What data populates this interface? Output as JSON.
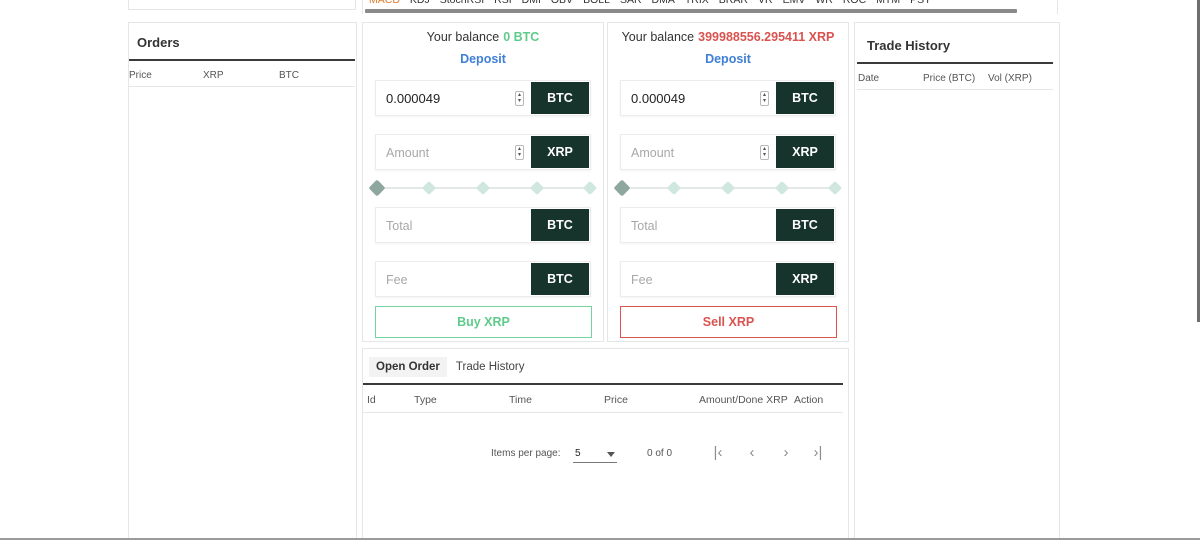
{
  "indicators": [
    "MACD",
    "KDJ",
    "StochRSI",
    "RSI",
    "DMI",
    "OBV",
    "BOLL",
    "SAR",
    "DMA",
    "TRIX",
    "BRAR",
    "VR",
    "EMV",
    "WR",
    "ROC",
    "MTM",
    "PSY"
  ],
  "orders": {
    "title": "Orders",
    "columns": [
      "Price",
      "XRP",
      "BTC"
    ]
  },
  "buy": {
    "balance_label": "Your balance",
    "balance_value": "0 BTC",
    "deposit": "Deposit",
    "price_value": "0.000049",
    "price_unit": "BTC",
    "amount_placeholder": "Amount",
    "amount_unit": "XRP",
    "total_placeholder": "Total",
    "total_unit": "BTC",
    "fee_placeholder": "Fee",
    "fee_unit": "BTC",
    "action": "Buy XRP",
    "accent": "#5ecb8a"
  },
  "sell": {
    "balance_label": "Your balance",
    "balance_value": "399988556.295411 XRP",
    "deposit": "Deposit",
    "price_value": "0.000049",
    "price_unit": "BTC",
    "amount_placeholder": "Amount",
    "amount_unit": "XRP",
    "total_placeholder": "Total",
    "total_unit": "BTC",
    "fee_placeholder": "Fee",
    "fee_unit": "XRP",
    "action": "Sell XRP",
    "accent": "#d9534f"
  },
  "open_orders": {
    "tabs": [
      "Open Order",
      "Trade History"
    ],
    "columns": [
      "Id",
      "Type",
      "Time",
      "Price",
      "Amount/Done XRP",
      "Action"
    ],
    "items_per_page_label": "Items per page:",
    "items_per_page_value": "5",
    "range": "0 of 0"
  },
  "trade_history": {
    "title": "Trade History",
    "columns": [
      "Date",
      "Price (BTC)",
      "Vol (XRP)"
    ]
  }
}
